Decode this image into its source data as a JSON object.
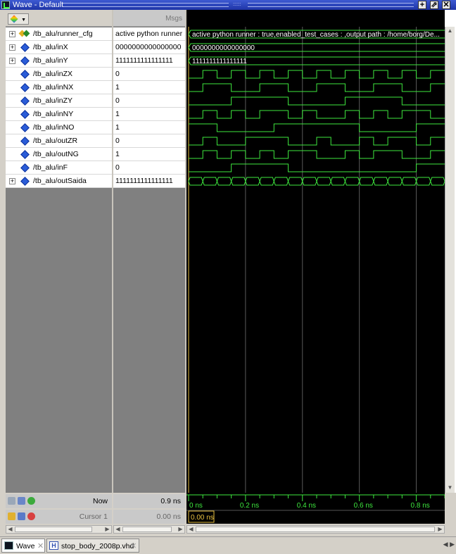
{
  "window": {
    "title": "Wave - Default",
    "buttons": [
      "+",
      "⇗",
      "✕"
    ]
  },
  "columns": {
    "msgs_header": "Msgs"
  },
  "signals": [
    {
      "name": "/tb_alu/runner_cfg",
      "value": "active python runner ...",
      "expandable": true,
      "icon": "config-icon",
      "wave": "string",
      "wave_label": "active python runner : true,enabled_test_cases : ,output path : /home/borg/De..."
    },
    {
      "name": "/tb_alu/inX",
      "value": "0000000000000000",
      "expandable": true,
      "icon": "diamond-icon",
      "wave": "bus-single",
      "wave_label": "0000000000000000"
    },
    {
      "name": "/tb_alu/inY",
      "value": "1111111111111111",
      "expandable": true,
      "icon": "diamond-icon",
      "wave": "bus-single",
      "wave_label": "1111111111111111"
    },
    {
      "name": "/tb_alu/inZX",
      "value": "0",
      "expandable": false,
      "icon": "diamond-icon",
      "wave": "bit",
      "levels": [
        0,
        1,
        0,
        1,
        0,
        1,
        0,
        1,
        0,
        1,
        0,
        1,
        0,
        1,
        0,
        1,
        0,
        1
      ]
    },
    {
      "name": "/tb_alu/inNX",
      "value": "1",
      "expandable": false,
      "icon": "diamond-icon",
      "wave": "bit",
      "levels": [
        0,
        1,
        1,
        0,
        0,
        1,
        1,
        0,
        0,
        1,
        1,
        0,
        0,
        1,
        1,
        0,
        0,
        1
      ]
    },
    {
      "name": "/tb_alu/inZY",
      "value": "0",
      "expandable": false,
      "icon": "diamond-icon",
      "wave": "bit",
      "levels": [
        0,
        0,
        0,
        1,
        1,
        1,
        1,
        0,
        0,
        0,
        0,
        1,
        1,
        1,
        1,
        0,
        0,
        0
      ]
    },
    {
      "name": "/tb_alu/inNY",
      "value": "1",
      "expandable": false,
      "icon": "diamond-icon",
      "wave": "bit",
      "levels": [
        0,
        1,
        0,
        1,
        0,
        1,
        1,
        0,
        1,
        0,
        0,
        1,
        0,
        1,
        0,
        1,
        1,
        0
      ]
    },
    {
      "name": "/tb_alu/inNO",
      "value": "1",
      "expandable": false,
      "icon": "diamond-icon",
      "wave": "bit",
      "levels": [
        1,
        1,
        0,
        0,
        0,
        0,
        1,
        1,
        1,
        1,
        1,
        1,
        0,
        0,
        0,
        0,
        1,
        1
      ]
    },
    {
      "name": "/tb_alu/outZR",
      "value": "0",
      "expandable": false,
      "icon": "diamond-icon",
      "wave": "bit",
      "levels": [
        0,
        1,
        0,
        0,
        1,
        1,
        1,
        0,
        0,
        1,
        0,
        0,
        1,
        0,
        1,
        1,
        0,
        1
      ]
    },
    {
      "name": "/tb_alu/outNG",
      "value": "1",
      "expandable": false,
      "icon": "diamond-icon",
      "wave": "bit",
      "levels": [
        0,
        1,
        0,
        1,
        0,
        1,
        0,
        1,
        1,
        0,
        0,
        1,
        0,
        1,
        1,
        0,
        0,
        1
      ]
    },
    {
      "name": "/tb_alu/inF",
      "value": "0",
      "expandable": false,
      "icon": "diamond-icon",
      "wave": "bit",
      "levels": [
        0,
        0,
        0,
        1,
        1,
        1,
        1,
        0,
        0,
        0,
        0,
        0,
        0,
        0,
        0,
        0,
        1,
        1
      ]
    },
    {
      "name": "/tb_alu/outSaida",
      "value": "1111111111111111",
      "expandable": true,
      "icon": "diamond-icon",
      "wave": "bus-multi"
    }
  ],
  "bottom": {
    "now_label": "Now",
    "now_value": "0.9 ns",
    "cursor_label": "Cursor 1",
    "cursor_value": "0.00 ns",
    "cursor_time_box": "0.00 ns",
    "time_ticks": [
      "0 ns",
      "0.2 ns",
      "0.4 ns",
      "0.6 ns",
      "0.8 ns"
    ],
    "time_range_ns": [
      0,
      0.9
    ]
  },
  "tabs": [
    {
      "label": "Wave",
      "icon": "wave-tab-icon",
      "active": true
    },
    {
      "label": "stop_body_2008p.vhd",
      "icon": "vhdl-file-icon",
      "active": false
    }
  ],
  "colors": {
    "wave": "#3ee83e",
    "background": "#000000",
    "cursor": "#e8c040",
    "grid": "#2f2f2f",
    "title_bar": "#2a44be"
  }
}
